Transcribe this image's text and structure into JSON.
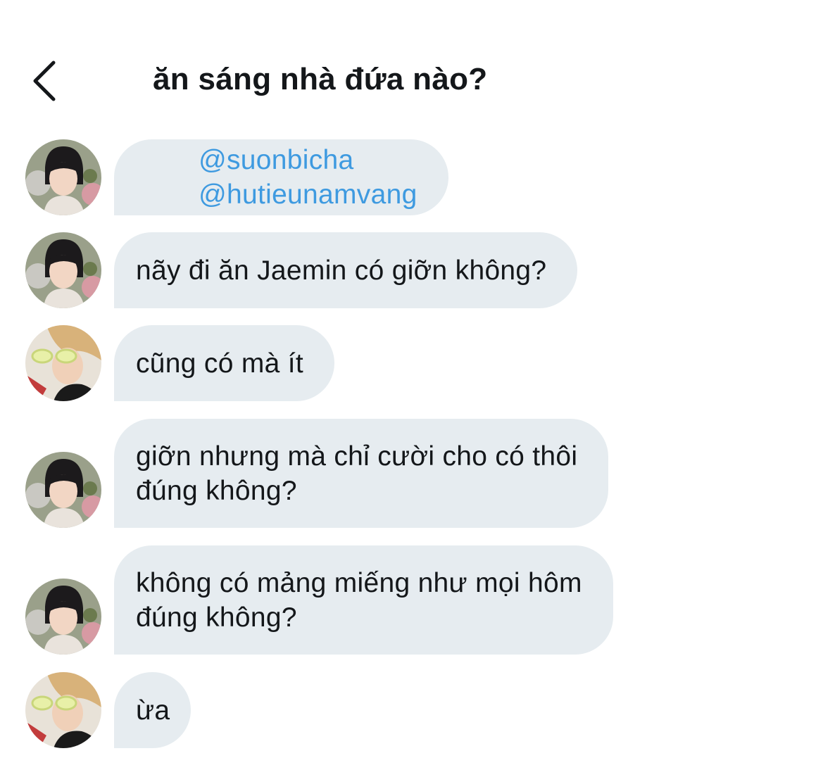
{
  "header": {
    "title": "ăn sáng nhà đứa nào?"
  },
  "messages": [
    {
      "sender": "user-a",
      "mentions": [
        "@suonbicha",
        "@hutieunamvang"
      ]
    },
    {
      "sender": "user-a",
      "text": "nãy đi ăn Jaemin có giỡn không?"
    },
    {
      "sender": "user-b",
      "text": "cũng có mà ít"
    },
    {
      "sender": "user-a",
      "text": "giỡn nhưng mà chỉ cười cho có thôi\nđúng không?"
    },
    {
      "sender": "user-a",
      "text": "không có mảng miếng như mọi hôm\nđúng không?"
    },
    {
      "sender": "user-b",
      "text": "ừa"
    }
  ],
  "colors": {
    "bubble_bg": "#e6ecf0",
    "mention": "#3e9ae0",
    "text": "#14171a"
  },
  "icons": {
    "back": "chevron-left-icon"
  }
}
